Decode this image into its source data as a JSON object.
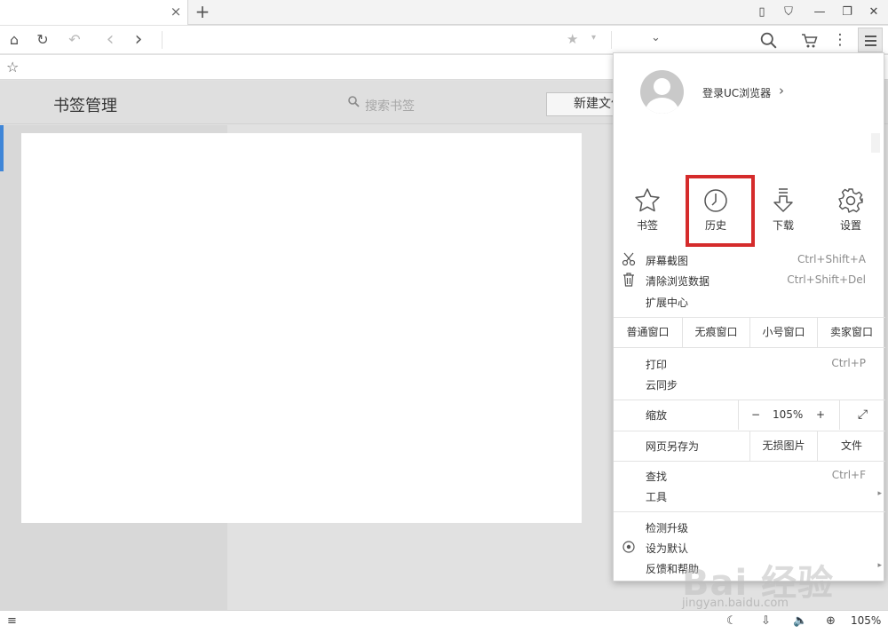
{
  "tab": {
    "close": "×",
    "new_tab": "+"
  },
  "window_buttons": [
    {
      "icon": "phone-icon",
      "glyph": "▯"
    },
    {
      "icon": "shirt-icon",
      "glyph": "⛉"
    },
    {
      "icon": "minimize-icon",
      "glyph": "—"
    },
    {
      "icon": "restore-icon",
      "glyph": "❐"
    },
    {
      "icon": "close-icon",
      "glyph": "✕"
    }
  ],
  "toolbar": {
    "home": "⌂",
    "refresh": "↻",
    "undo": "↶",
    "back": "‹",
    "forward": "›",
    "star": "★",
    "dropdown": "▾",
    "search_dropdown": "⌄",
    "search": "⚲",
    "cart": "🛒",
    "more": "⋮"
  },
  "bookmarks_bar": {
    "star": "☆"
  },
  "bookmark_manager": {
    "title": "书签管理",
    "search_placeholder": "搜索书签",
    "new_folder": "新建文件夹"
  },
  "menu": {
    "login": "登录UC浏览器",
    "login_arrow": "›",
    "quick": [
      {
        "label": "书签",
        "icon": "star-icon"
      },
      {
        "label": "历史",
        "icon": "history-clock-icon"
      },
      {
        "label": "下载",
        "icon": "download-icon"
      },
      {
        "label": "设置",
        "icon": "gear-icon"
      }
    ],
    "tools": [
      {
        "label": "屏幕截图",
        "shortcut": "Ctrl+Shift+A",
        "icon": "scissors-icon"
      },
      {
        "label": "清除浏览数据",
        "shortcut": "Ctrl+Shift+Del",
        "icon": "trash-icon"
      },
      {
        "label": "扩展中心",
        "shortcut": ""
      }
    ],
    "windows": [
      "普通窗口",
      "无痕窗口",
      "小号窗口",
      "卖家窗口"
    ],
    "print": {
      "label": "打印",
      "shortcut": "Ctrl+P"
    },
    "cloud_sync": "云同步",
    "zoom": {
      "label": "缩放",
      "minus": "−",
      "value": "105%",
      "plus": "+",
      "fullscreen": "⤢"
    },
    "save_as": {
      "label": "网页另存为",
      "lossless": "无损图片",
      "file": "文件"
    },
    "find": {
      "label": "查找",
      "shortcut": "Ctrl+F"
    },
    "tools_menu": {
      "label": "工具",
      "arrow": "▸"
    },
    "check_update": "检测升级",
    "set_default": "设为默认",
    "feedback": {
      "label": "反馈和帮助",
      "arrow": "▸"
    }
  },
  "statusbar": {
    "sidebar": "≡",
    "night": "☾",
    "download": "⇩",
    "volume": "🔈",
    "zoom_icon": "⊕",
    "zoom": "105%"
  },
  "watermark": {
    "logo": "Bai 经验",
    "url": "jingyan.baidu.com"
  }
}
